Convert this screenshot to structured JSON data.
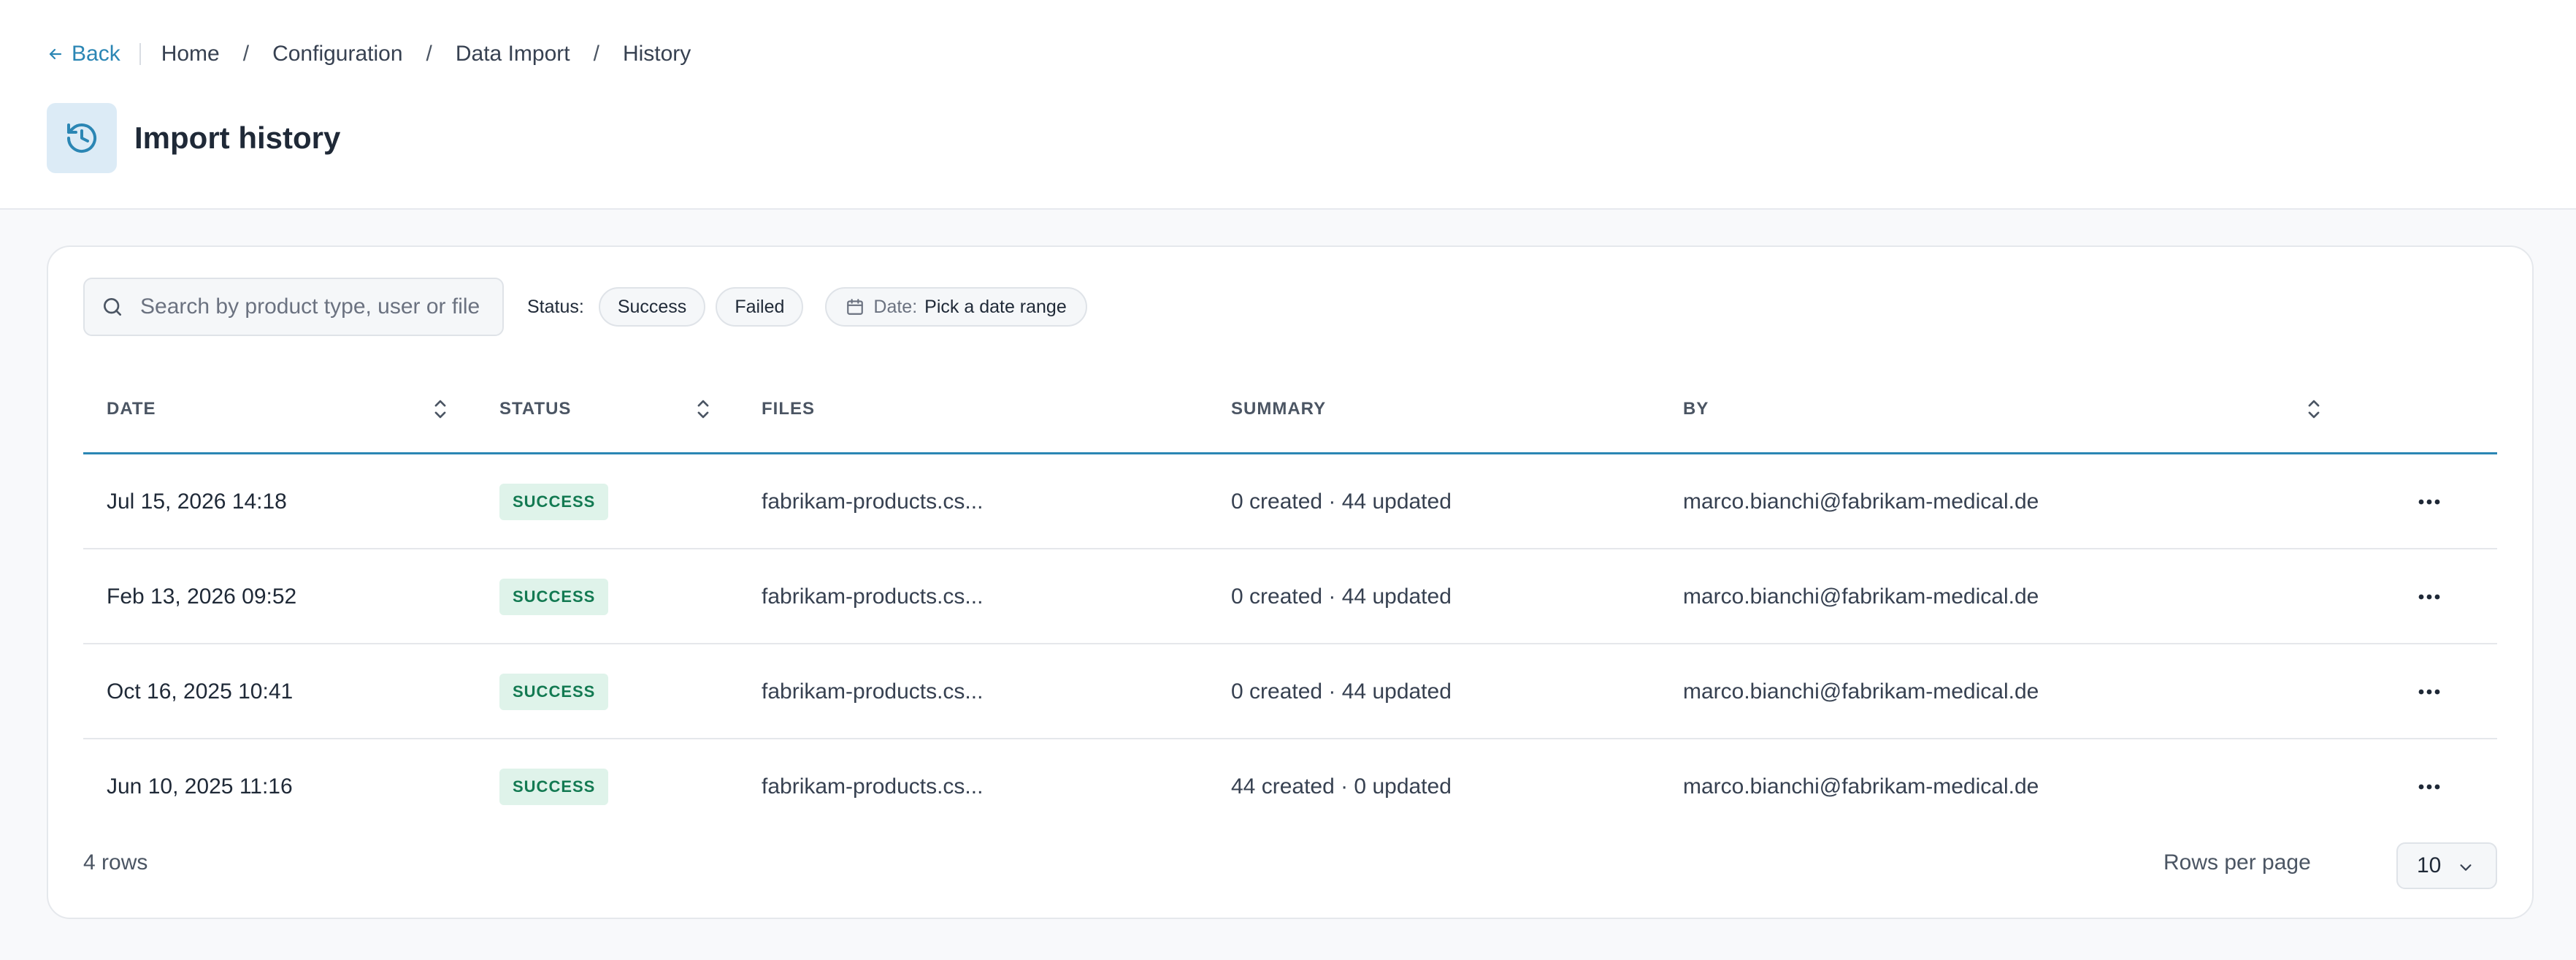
{
  "breadcrumb": {
    "back_label": "Back",
    "items": [
      "Home",
      "Configuration",
      "Data Import",
      "History"
    ],
    "separator": "/"
  },
  "page": {
    "title": "Import history",
    "icon": "history-icon"
  },
  "filters": {
    "search_placeholder": "Search by product type, user or file",
    "status_label": "Status:",
    "status_options": [
      "Success",
      "Failed"
    ],
    "date_label": "Date:",
    "date_value": "Pick a date range"
  },
  "table": {
    "columns": [
      "DATE",
      "STATUS",
      "FILES",
      "SUMMARY",
      "BY"
    ],
    "rows": [
      {
        "date": "Jul 15, 2026 14:18",
        "status": "SUCCESS",
        "file": "fabrikam-products.cs...",
        "summary": "0 created · 44 updated",
        "by": "marco.bianchi@fabrikam-medical.de"
      },
      {
        "date": "Feb 13, 2026 09:52",
        "status": "SUCCESS",
        "file": "fabrikam-products.cs...",
        "summary": "0 created · 44 updated",
        "by": "marco.bianchi@fabrikam-medical.de"
      },
      {
        "date": "Oct 16, 2025 10:41",
        "status": "SUCCESS",
        "file": "fabrikam-products.cs...",
        "summary": "0 created · 44 updated",
        "by": "marco.bianchi@fabrikam-medical.de"
      },
      {
        "date": "Jun 10, 2025 11:16",
        "status": "SUCCESS",
        "file": "fabrikam-products.cs...",
        "summary": "44 created · 0 updated",
        "by": "marco.bianchi@fabrikam-medical.de"
      }
    ]
  },
  "footer": {
    "row_count": "4 rows",
    "rows_per_page_label": "Rows per page",
    "rows_per_page_value": "10"
  },
  "colors": {
    "accent": "#2b86b4",
    "success_bg": "#dff3ea",
    "success_text": "#137a52",
    "page_bg": "#f8f9fb"
  }
}
